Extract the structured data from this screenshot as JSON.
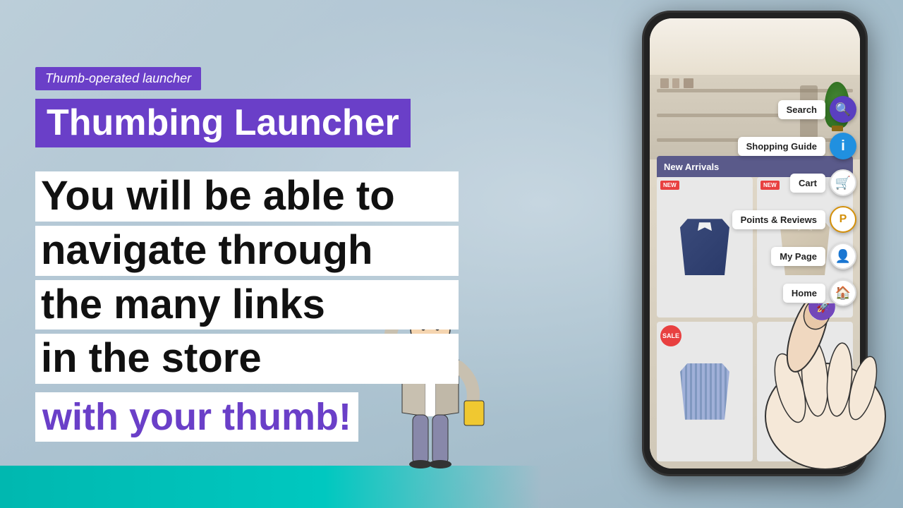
{
  "subtitle": "Thumb-operated launcher",
  "title": "Thumbing Launcher",
  "body_lines": [
    "You will be able to",
    "navigate through",
    "the many links",
    "in the store"
  ],
  "highlight": "with your thumb!",
  "menu": {
    "items": [
      {
        "label": "Search",
        "icon": "🔍",
        "icon_class": "icon-search",
        "icon_name": "search-icon"
      },
      {
        "label": "Shopping Guide",
        "icon": "ℹ",
        "icon_class": "icon-info",
        "icon_name": "shopping-guide-icon"
      },
      {
        "label": "Cart",
        "icon": "🛒",
        "icon_class": "icon-cart",
        "icon_name": "cart-icon"
      },
      {
        "label": "Points & Reviews",
        "icon": "Ⓟ",
        "icon_class": "icon-points",
        "icon_name": "points-icon"
      },
      {
        "label": "My Page",
        "icon": "👤",
        "icon_class": "icon-mypage",
        "icon_name": "mypage-icon"
      },
      {
        "label": "Home",
        "icon": "🏠",
        "icon_class": "icon-home",
        "icon_name": "home-icon"
      }
    ]
  },
  "store": {
    "banner": "New Arrivals",
    "badge_new": "NEW",
    "badge_sale": "SALE"
  },
  "colors": {
    "purple": "#6a3fc8",
    "teal": "#00b8b0",
    "dark": "#111111",
    "white": "#ffffff"
  }
}
